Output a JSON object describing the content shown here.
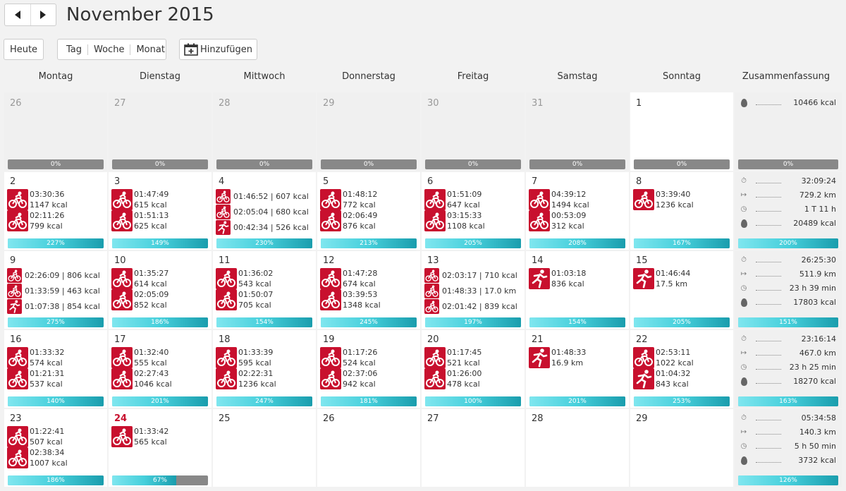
{
  "header": {
    "title": "November 2015",
    "prev_icon": "arrow-left-icon",
    "next_icon": "arrow-right-icon"
  },
  "toolbar": {
    "today": "Heute",
    "views": [
      "Tag",
      "Woche",
      "Monat"
    ],
    "add": "Hinzufügen",
    "add_icon": "calendar-add-icon"
  },
  "weekdays": [
    "Montag",
    "Dienstag",
    "Mittwoch",
    "Donnerstag",
    "Freitag",
    "Samstag",
    "Sonntag",
    "Zusammenfassung"
  ],
  "colors": {
    "accent": "#c8102e",
    "bar_fill": "#46cfdb",
    "bar_empty": "#888888"
  },
  "weeks": [
    {
      "days": [
        {
          "num": "26",
          "state": "other",
          "acts": [],
          "pct": "0%",
          "pct_value": 0
        },
        {
          "num": "27",
          "state": "other",
          "acts": [],
          "pct": "0%",
          "pct_value": 0
        },
        {
          "num": "28",
          "state": "other",
          "acts": [],
          "pct": "0%",
          "pct_value": 0
        },
        {
          "num": "29",
          "state": "other",
          "acts": [],
          "pct": "0%",
          "pct_value": 0
        },
        {
          "num": "30",
          "state": "other",
          "acts": [],
          "pct": "0%",
          "pct_value": 0
        },
        {
          "num": "31",
          "state": "other",
          "acts": [],
          "pct": "0%",
          "pct_value": 0
        },
        {
          "num": "1",
          "state": "current",
          "acts": [],
          "pct": "0%",
          "pct_value": 0
        }
      ],
      "summary": {
        "rows": [
          {
            "icon": "flame-icon",
            "value": "10466 kcal"
          }
        ],
        "pct": "0%",
        "pct_value": 0
      }
    },
    {
      "days": [
        {
          "num": "2",
          "acts": [
            {
              "icon": "bike-icon",
              "l1": "03:30:36",
              "l2": "1147 kcal"
            },
            {
              "icon": "bike-icon",
              "l1": "02:11:26",
              "l2": "799 kcal"
            }
          ],
          "pct": "227%",
          "pct_value": 227
        },
        {
          "num": "3",
          "acts": [
            {
              "icon": "bike-icon",
              "l1": "01:47:49",
              "l2": "615 kcal"
            },
            {
              "icon": "bike-icon",
              "l1": "01:51:13",
              "l2": "625 kcal"
            }
          ],
          "pct": "149%",
          "pct_value": 149
        },
        {
          "num": "4",
          "compact": true,
          "acts": [
            {
              "icon": "bike-icon",
              "l1": "01:46:52 | 607 kcal"
            },
            {
              "icon": "bike-icon",
              "l1": "02:05:04 | 680 kcal"
            },
            {
              "icon": "run-icon",
              "l1": "00:42:34 | 526 kcal"
            }
          ],
          "pct": "230%",
          "pct_value": 230
        },
        {
          "num": "5",
          "acts": [
            {
              "icon": "bike-icon",
              "l1": "01:48:12",
              "l2": "772 kcal"
            },
            {
              "icon": "bike-icon",
              "l1": "02:06:49",
              "l2": "876 kcal"
            }
          ],
          "pct": "213%",
          "pct_value": 213
        },
        {
          "num": "6",
          "acts": [
            {
              "icon": "bike-icon",
              "l1": "01:51:09",
              "l2": "647 kcal"
            },
            {
              "icon": "bike-icon",
              "l1": "03:15:33",
              "l2": "1108 kcal"
            }
          ],
          "pct": "205%",
          "pct_value": 205
        },
        {
          "num": "7",
          "acts": [
            {
              "icon": "bike-icon",
              "l1": "04:39:12",
              "l2": "1494 kcal"
            },
            {
              "icon": "bike-icon",
              "l1": "00:53:09",
              "l2": "312 kcal"
            }
          ],
          "pct": "208%",
          "pct_value": 208
        },
        {
          "num": "8",
          "acts": [
            {
              "icon": "bike-icon",
              "l1": "03:39:40",
              "l2": "1236 kcal"
            }
          ],
          "pct": "167%",
          "pct_value": 167
        }
      ],
      "summary": {
        "rows": [
          {
            "icon": "stopwatch-icon",
            "value": "32:09:24"
          },
          {
            "icon": "distance-icon",
            "value": "729.2 km"
          },
          {
            "icon": "elapsed-icon",
            "value": "1 T 11 h"
          },
          {
            "icon": "flame-icon",
            "value": "20489 kcal"
          }
        ],
        "pct": "200%",
        "pct_value": 200
      }
    },
    {
      "days": [
        {
          "num": "9",
          "compact": true,
          "acts": [
            {
              "icon": "bike-icon",
              "l1": "02:26:09 | 806 kcal"
            },
            {
              "icon": "bike-icon",
              "l1": "01:33:59 | 463 kcal"
            },
            {
              "icon": "run-icon",
              "l1": "01:07:38 | 854 kcal"
            }
          ],
          "pct": "275%",
          "pct_value": 275
        },
        {
          "num": "10",
          "acts": [
            {
              "icon": "bike-icon",
              "l1": "01:35:27",
              "l2": "614 kcal"
            },
            {
              "icon": "bike-icon",
              "l1": "02:05:09",
              "l2": "852 kcal"
            }
          ],
          "pct": "186%",
          "pct_value": 186
        },
        {
          "num": "11",
          "acts": [
            {
              "icon": "bike-icon",
              "l1": "01:36:02",
              "l2": "543 kcal"
            },
            {
              "icon": "bike-icon",
              "l1": "01:50:07",
              "l2": "705 kcal"
            }
          ],
          "pct": "154%",
          "pct_value": 154
        },
        {
          "num": "12",
          "acts": [
            {
              "icon": "bike-icon",
              "l1": "01:47:28",
              "l2": "674 kcal"
            },
            {
              "icon": "bike-icon",
              "l1": "03:39:53",
              "l2": "1348 kcal"
            }
          ],
          "pct": "245%",
          "pct_value": 245
        },
        {
          "num": "13",
          "compact": true,
          "acts": [
            {
              "icon": "bike-icon",
              "l1": "02:03:17 | 710 kcal"
            },
            {
              "icon": "bike-icon",
              "l1": "01:48:33 | 17.0 km"
            },
            {
              "icon": "bike-icon",
              "l1": "02:01:42 | 839 kcal"
            }
          ],
          "pct": "197%",
          "pct_value": 197
        },
        {
          "num": "14",
          "acts": [
            {
              "icon": "run-icon",
              "l1": "01:03:18",
              "l2": "836 kcal"
            }
          ],
          "pct": "154%",
          "pct_value": 154
        },
        {
          "num": "15",
          "acts": [
            {
              "icon": "run-icon",
              "l1": "01:46:44",
              "l2": "17.5 km"
            }
          ],
          "pct": "205%",
          "pct_value": 205
        }
      ],
      "summary": {
        "rows": [
          {
            "icon": "stopwatch-icon",
            "value": "26:25:30"
          },
          {
            "icon": "distance-icon",
            "value": "511.9 km"
          },
          {
            "icon": "elapsed-icon",
            "value": "23 h 39 min"
          },
          {
            "icon": "flame-icon",
            "value": "17803 kcal"
          }
        ],
        "pct": "151%",
        "pct_value": 151
      }
    },
    {
      "days": [
        {
          "num": "16",
          "acts": [
            {
              "icon": "bike-icon",
              "l1": "01:33:32",
              "l2": "574 kcal"
            },
            {
              "icon": "bike-icon",
              "l1": "01:21:31",
              "l2": "537 kcal"
            }
          ],
          "pct": "140%",
          "pct_value": 140
        },
        {
          "num": "17",
          "acts": [
            {
              "icon": "bike-icon",
              "l1": "01:32:40",
              "l2": "555 kcal"
            },
            {
              "icon": "bike-icon",
              "l1": "02:27:43",
              "l2": "1046 kcal"
            }
          ],
          "pct": "201%",
          "pct_value": 201
        },
        {
          "num": "18",
          "acts": [
            {
              "icon": "bike-icon",
              "l1": "01:33:39",
              "l2": "595 kcal"
            },
            {
              "icon": "bike-icon",
              "l1": "02:22:31",
              "l2": "1236 kcal"
            }
          ],
          "pct": "247%",
          "pct_value": 247
        },
        {
          "num": "19",
          "acts": [
            {
              "icon": "bike-icon",
              "l1": "01:17:26",
              "l2": "524 kcal"
            },
            {
              "icon": "bike-icon",
              "l1": "02:37:06",
              "l2": "942 kcal"
            }
          ],
          "pct": "181%",
          "pct_value": 181
        },
        {
          "num": "20",
          "acts": [
            {
              "icon": "bike-icon",
              "l1": "01:17:45",
              "l2": "521 kcal"
            },
            {
              "icon": "bike-icon",
              "l1": "01:26:00",
              "l2": "478 kcal"
            }
          ],
          "pct": "100%",
          "pct_value": 100
        },
        {
          "num": "21",
          "acts": [
            {
              "icon": "run-icon",
              "l1": "01:48:33",
              "l2": "16.9 km"
            }
          ],
          "pct": "201%",
          "pct_value": 201
        },
        {
          "num": "22",
          "acts": [
            {
              "icon": "bike-icon",
              "l1": "02:53:11",
              "l2": "1022 kcal"
            },
            {
              "icon": "run-icon",
              "l1": "01:04:32",
              "l2": "843 kcal"
            }
          ],
          "pct": "253%",
          "pct_value": 253
        }
      ],
      "summary": {
        "rows": [
          {
            "icon": "stopwatch-icon",
            "value": "23:16:14"
          },
          {
            "icon": "distance-icon",
            "value": "467.0 km"
          },
          {
            "icon": "elapsed-icon",
            "value": "23 h 25 min"
          },
          {
            "icon": "flame-icon",
            "value": "18270 kcal"
          }
        ],
        "pct": "163%",
        "pct_value": 163
      }
    },
    {
      "days": [
        {
          "num": "23",
          "acts": [
            {
              "icon": "bike-icon",
              "l1": "01:22:41",
              "l2": "507 kcal"
            },
            {
              "icon": "bike-icon",
              "l1": "02:38:34",
              "l2": "1007 kcal"
            }
          ],
          "pct": "186%",
          "pct_value": 186
        },
        {
          "num": "24",
          "state": "today",
          "acts": [
            {
              "icon": "bike-icon",
              "l1": "01:33:42",
              "l2": "565 kcal"
            }
          ],
          "pct": "67%",
          "pct_value": 67
        },
        {
          "num": "25",
          "acts": []
        },
        {
          "num": "26",
          "acts": []
        },
        {
          "num": "27",
          "acts": []
        },
        {
          "num": "28",
          "acts": []
        },
        {
          "num": "29",
          "acts": []
        }
      ],
      "summary": {
        "rows": [
          {
            "icon": "stopwatch-icon",
            "value": "05:34:58"
          },
          {
            "icon": "distance-icon",
            "value": "140.3 km"
          },
          {
            "icon": "elapsed-icon",
            "value": "5 h 50 min"
          },
          {
            "icon": "flame-icon",
            "value": "3732 kcal"
          }
        ],
        "pct": "126%",
        "pct_value": 126
      }
    }
  ]
}
